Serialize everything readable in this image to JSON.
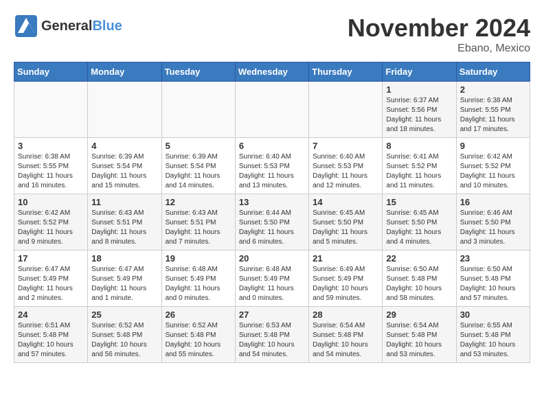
{
  "header": {
    "logo_general": "General",
    "logo_blue": "Blue",
    "month_title": "November 2024",
    "location": "Ebano, Mexico"
  },
  "days_of_week": [
    "Sunday",
    "Monday",
    "Tuesday",
    "Wednesday",
    "Thursday",
    "Friday",
    "Saturday"
  ],
  "weeks": [
    [
      {
        "day": "",
        "info": ""
      },
      {
        "day": "",
        "info": ""
      },
      {
        "day": "",
        "info": ""
      },
      {
        "day": "",
        "info": ""
      },
      {
        "day": "",
        "info": ""
      },
      {
        "day": "1",
        "info": "Sunrise: 6:37 AM\nSunset: 5:56 PM\nDaylight: 11 hours and 18 minutes."
      },
      {
        "day": "2",
        "info": "Sunrise: 6:38 AM\nSunset: 5:55 PM\nDaylight: 11 hours and 17 minutes."
      }
    ],
    [
      {
        "day": "3",
        "info": "Sunrise: 6:38 AM\nSunset: 5:55 PM\nDaylight: 11 hours and 16 minutes."
      },
      {
        "day": "4",
        "info": "Sunrise: 6:39 AM\nSunset: 5:54 PM\nDaylight: 11 hours and 15 minutes."
      },
      {
        "day": "5",
        "info": "Sunrise: 6:39 AM\nSunset: 5:54 PM\nDaylight: 11 hours and 14 minutes."
      },
      {
        "day": "6",
        "info": "Sunrise: 6:40 AM\nSunset: 5:53 PM\nDaylight: 11 hours and 13 minutes."
      },
      {
        "day": "7",
        "info": "Sunrise: 6:40 AM\nSunset: 5:53 PM\nDaylight: 11 hours and 12 minutes."
      },
      {
        "day": "8",
        "info": "Sunrise: 6:41 AM\nSunset: 5:52 PM\nDaylight: 11 hours and 11 minutes."
      },
      {
        "day": "9",
        "info": "Sunrise: 6:42 AM\nSunset: 5:52 PM\nDaylight: 11 hours and 10 minutes."
      }
    ],
    [
      {
        "day": "10",
        "info": "Sunrise: 6:42 AM\nSunset: 5:52 PM\nDaylight: 11 hours and 9 minutes."
      },
      {
        "day": "11",
        "info": "Sunrise: 6:43 AM\nSunset: 5:51 PM\nDaylight: 11 hours and 8 minutes."
      },
      {
        "day": "12",
        "info": "Sunrise: 6:43 AM\nSunset: 5:51 PM\nDaylight: 11 hours and 7 minutes."
      },
      {
        "day": "13",
        "info": "Sunrise: 6:44 AM\nSunset: 5:50 PM\nDaylight: 11 hours and 6 minutes."
      },
      {
        "day": "14",
        "info": "Sunrise: 6:45 AM\nSunset: 5:50 PM\nDaylight: 11 hours and 5 minutes."
      },
      {
        "day": "15",
        "info": "Sunrise: 6:45 AM\nSunset: 5:50 PM\nDaylight: 11 hours and 4 minutes."
      },
      {
        "day": "16",
        "info": "Sunrise: 6:46 AM\nSunset: 5:50 PM\nDaylight: 11 hours and 3 minutes."
      }
    ],
    [
      {
        "day": "17",
        "info": "Sunrise: 6:47 AM\nSunset: 5:49 PM\nDaylight: 11 hours and 2 minutes."
      },
      {
        "day": "18",
        "info": "Sunrise: 6:47 AM\nSunset: 5:49 PM\nDaylight: 11 hours and 1 minute."
      },
      {
        "day": "19",
        "info": "Sunrise: 6:48 AM\nSunset: 5:49 PM\nDaylight: 11 hours and 0 minutes."
      },
      {
        "day": "20",
        "info": "Sunrise: 6:48 AM\nSunset: 5:49 PM\nDaylight: 11 hours and 0 minutes."
      },
      {
        "day": "21",
        "info": "Sunrise: 6:49 AM\nSunset: 5:49 PM\nDaylight: 10 hours and 59 minutes."
      },
      {
        "day": "22",
        "info": "Sunrise: 6:50 AM\nSunset: 5:48 PM\nDaylight: 10 hours and 58 minutes."
      },
      {
        "day": "23",
        "info": "Sunrise: 6:50 AM\nSunset: 5:48 PM\nDaylight: 10 hours and 57 minutes."
      }
    ],
    [
      {
        "day": "24",
        "info": "Sunrise: 6:51 AM\nSunset: 5:48 PM\nDaylight: 10 hours and 57 minutes."
      },
      {
        "day": "25",
        "info": "Sunrise: 6:52 AM\nSunset: 5:48 PM\nDaylight: 10 hours and 56 minutes."
      },
      {
        "day": "26",
        "info": "Sunrise: 6:52 AM\nSunset: 5:48 PM\nDaylight: 10 hours and 55 minutes."
      },
      {
        "day": "27",
        "info": "Sunrise: 6:53 AM\nSunset: 5:48 PM\nDaylight: 10 hours and 54 minutes."
      },
      {
        "day": "28",
        "info": "Sunrise: 6:54 AM\nSunset: 5:48 PM\nDaylight: 10 hours and 54 minutes."
      },
      {
        "day": "29",
        "info": "Sunrise: 6:54 AM\nSunset: 5:48 PM\nDaylight: 10 hours and 53 minutes."
      },
      {
        "day": "30",
        "info": "Sunrise: 6:55 AM\nSunset: 5:48 PM\nDaylight: 10 hours and 53 minutes."
      }
    ]
  ]
}
